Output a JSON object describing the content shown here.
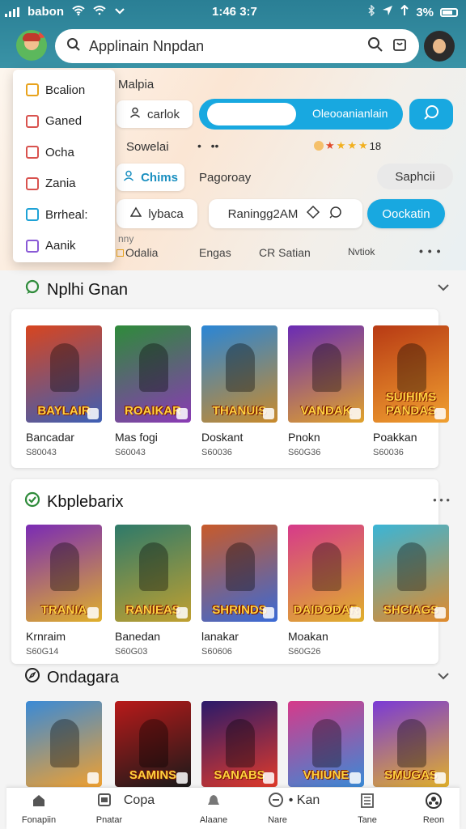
{
  "status_bar": {
    "carrier": "babon",
    "time": "1:46 3:7",
    "battery": "3%"
  },
  "search": {
    "placeholder": "Applinain Nnpdan"
  },
  "dropdown": {
    "items": [
      {
        "label": "Bcalion",
        "color": "#e8a31d"
      },
      {
        "label": "Ganed",
        "color": "#d9534f"
      },
      {
        "label": "Ocha",
        "color": "#d9534f"
      },
      {
        "label": "Zania",
        "color": "#d9534f"
      },
      {
        "label": "Brrheal:",
        "color": "#1fa2d6"
      },
      {
        "label": "Aanik",
        "color": "#8a5ad6"
      }
    ]
  },
  "filters": {
    "malpia": "Malpia",
    "carlok": "carlok",
    "blue_bar_label": "Oleooanianlain",
    "sowelai": "Sowelai",
    "rating_value": "18",
    "chims": "Chims",
    "pagoroay": "Pagoroay",
    "saphcii": "Saphcii",
    "lybaca": "lybaca",
    "ranking": "Raningg2AM",
    "oockatin": "Oockatin",
    "tabs": [
      "Odalia",
      "Engas",
      "CR Satian",
      "Nvtiok"
    ],
    "more": "• • •",
    "cut_label": "nny"
  },
  "sections": [
    {
      "title": "Nplhi Gnan",
      "games": [
        {
          "art": "BAYLAIR",
          "name": "Bancadar",
          "price": "S80043",
          "c1": "#d8451f",
          "c2": "#3d5fb5"
        },
        {
          "art": "ROAIKAR",
          "name": "Mas fogi",
          "price": "S60043",
          "c1": "#2e8b3a",
          "c2": "#8a3ab5"
        },
        {
          "art": "THANUIS",
          "name": "Doskant",
          "price": "S60036",
          "c1": "#2a86d6",
          "c2": "#c98a2b"
        },
        {
          "art": "VANDAK",
          "name": "Pnokn",
          "price": "S60G36",
          "c1": "#6a2bb5",
          "c2": "#e0a22b"
        },
        {
          "art": "SUIHIMS PANDAS",
          "name": "Poakkan",
          "price": "S60036",
          "c1": "#b83a14",
          "c2": "#f0a030"
        }
      ]
    },
    {
      "title": "Kbplebarix",
      "games": [
        {
          "art": "TRANIA",
          "name": "Krnraim",
          "price": "S60G14",
          "c1": "#7a2bb5",
          "c2": "#e0b02b"
        },
        {
          "art": "RANIEAS",
          "name": "Banedan",
          "price": "S60G03",
          "c1": "#2e7a6a",
          "c2": "#c0a030"
        },
        {
          "art": "SHRINDS",
          "name": "lanakar",
          "price": "S60606",
          "c1": "#c85a2a",
          "c2": "#3a6ad6"
        },
        {
          "art": "DAIDODAR",
          "name": "Moakan",
          "price": "S60G26",
          "c1": "#d63a8a",
          "c2": "#e0b02b"
        },
        {
          "art": "SHCIAGS",
          "name": "",
          "price": "",
          "c1": "#3ab5d6",
          "c2": "#e08a2b"
        }
      ]
    },
    {
      "title": "Ondagara",
      "games": [
        {
          "art": "",
          "name": "",
          "price": "",
          "c1": "#3a8ad6",
          "c2": "#f0a030"
        },
        {
          "art": "SAMINS",
          "name": "",
          "price": "",
          "c1": "#b81a1a",
          "c2": "#1a1a1a"
        },
        {
          "art": "SANABS",
          "name": "",
          "price": "",
          "c1": "#2a1a6a",
          "c2": "#e03a2a"
        },
        {
          "art": "VHIUNE",
          "name": "",
          "price": "",
          "c1": "#d63a8a",
          "c2": "#3a8ad6"
        },
        {
          "art": "SMUGAS",
          "name": "",
          "price": "",
          "c1": "#7a3ad6",
          "c2": "#e0b02b"
        }
      ]
    }
  ],
  "bottom_nav": [
    {
      "label": "Fonapiin",
      "icon": "home-icon"
    },
    {
      "label": "Pnatar",
      "icon": "store-icon",
      "extra": "Copa"
    },
    {
      "label": "Alaane",
      "icon": "bell-icon"
    },
    {
      "label": "Nare",
      "icon": "compass-icon",
      "extra": "• Kan"
    },
    {
      "label": "Tane",
      "icon": "list-icon"
    },
    {
      "label": "Reon",
      "icon": "ball-icon"
    }
  ]
}
